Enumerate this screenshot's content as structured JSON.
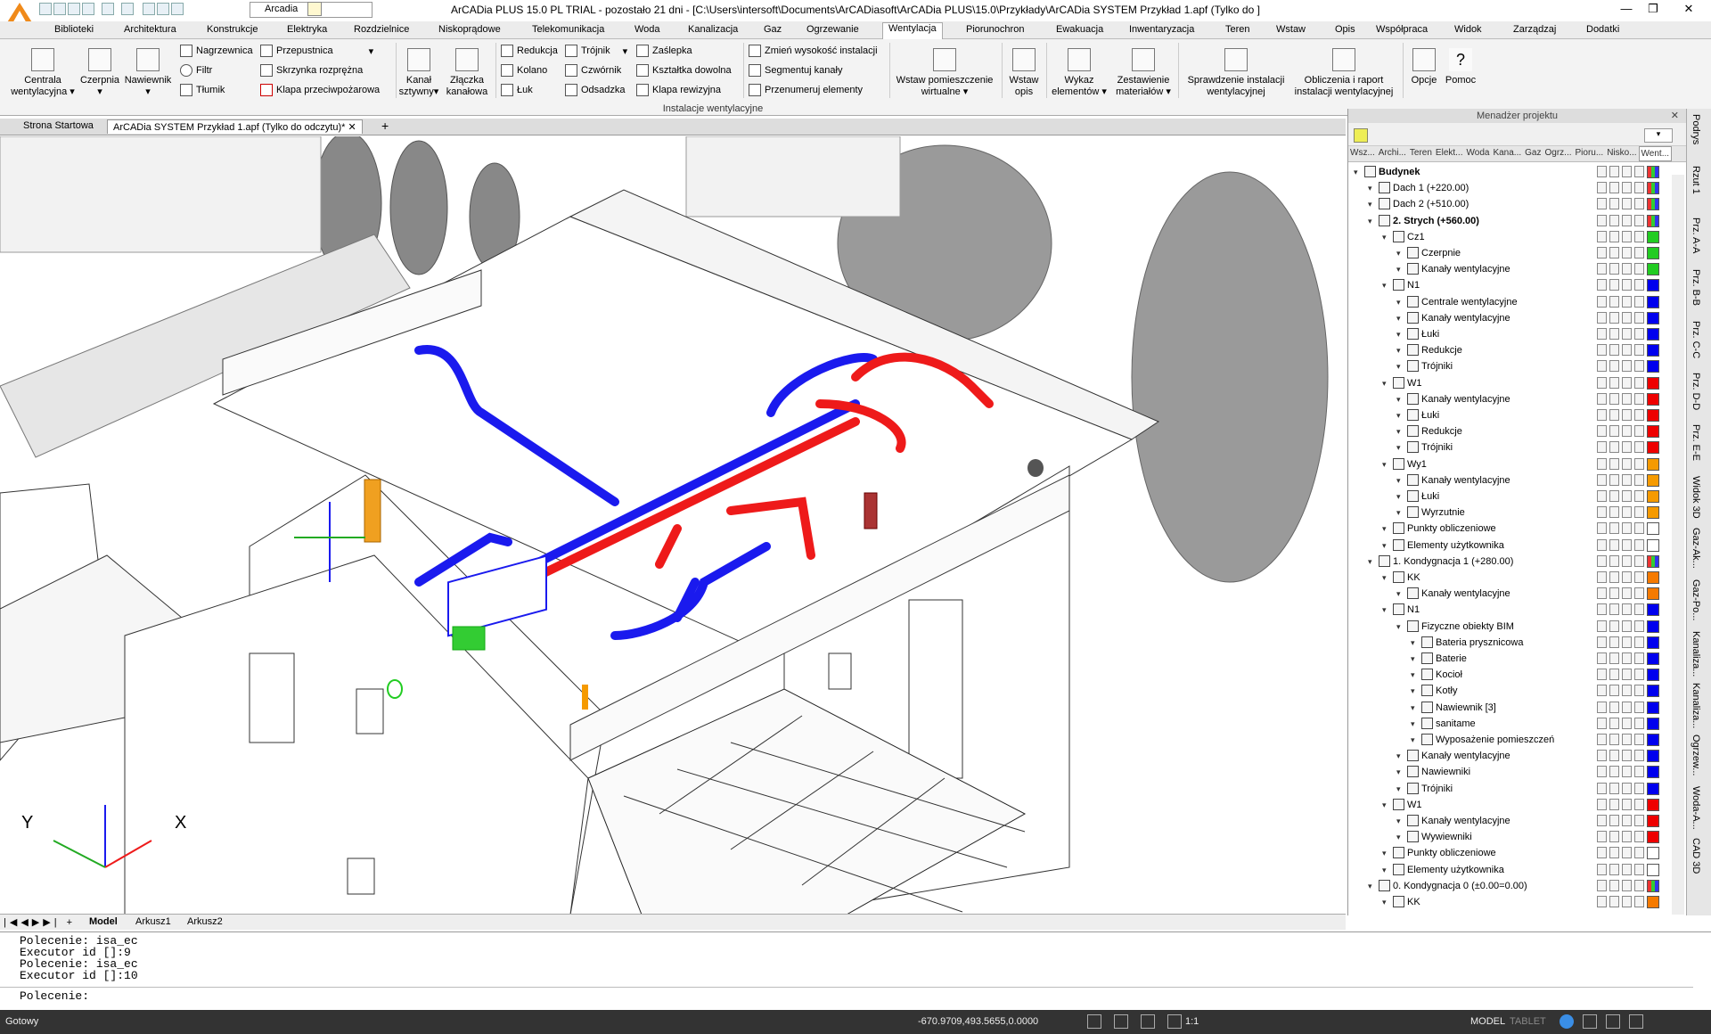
{
  "window": {
    "title": "ArCADia PLUS 15.0 PL TRIAL - pozostało 21 dni - [C:\\Users\\intersoft\\Documents\\ArCADiasoft\\ArCADia PLUS\\15.0\\Przykłady\\ArCADia SYSTEM Przykład 1.apf (Tylko do ]",
    "layer": "Arcadia"
  },
  "menu": [
    "Biblioteki",
    "Architektura",
    "Konstrukcje",
    "Elektryka",
    "Rozdzielnice",
    "Niskoprądowe",
    "Telekomunikacja",
    "Woda",
    "Kanalizacja",
    "Gaz",
    "Ogrzewanie",
    "Wentylacja",
    "Piorunochron",
    "Ewakuacja",
    "Inwentaryzacja",
    "Teren",
    "Wstaw",
    "Opis",
    "Współpraca",
    "Widok",
    "Zarządzaj",
    "Dodatki"
  ],
  "ribbon": {
    "centrala": "Centrala\nwentylacyjna",
    "czerpnia": "Czerpnia",
    "nawiewnik": "Nawiewnik",
    "nagrzewnica": "Nagrzewnica",
    "filtr": "Filtr",
    "tlumik": "Tłumik",
    "przepustnica": "Przepustnica",
    "skrzynka": "Skrzynka rozprężna",
    "klapa_pozarowa": "Klapa przeciwpożarowa",
    "kanal": "Kanał\nsztywny",
    "zlaczka": "Złączka\nkanałowa",
    "redukcja": "Redukcja",
    "kolano": "Kolano",
    "luk": "Łuk",
    "trojnik": "Trójnik",
    "czwornik": "Czwórnik",
    "odsadzka": "Odsadzka",
    "zaslepka": "Zaślepka",
    "ksztaltka": "Kształtka dowolna",
    "klapa_rewizyjna": "Klapa rewizyjna",
    "zmien": "Zmień wysokość instalacji",
    "segmentuj": "Segmentuj kanały",
    "przenumeruj": "Przenumeruj elementy",
    "wstaw_pom": "Wstaw pomieszczenie\nwirtualne",
    "wstaw_opis": "Wstaw\nopis",
    "wykaz": "Wykaz\nelementów",
    "zestawienie": "Zestawienie\nmateriałów",
    "sprawdzenie": "Sprawdzenie instalacji\nwentylacyjnej",
    "obliczenia": "Obliczenia i raport\ninstalacji wentylacyjnej",
    "opcje": "Opcje",
    "pomoc": "Pomoc",
    "caption": "Instalacje wentylacyjne"
  },
  "doc_tabs": [
    "Strona Startowa",
    "ArCADia SYSTEM Przykład 1.apf (Tylko do odczytu)*"
  ],
  "sheet_tabs": [
    "Model",
    "Arkusz1",
    "Arkusz2"
  ],
  "axis": {
    "x": "X",
    "y": "Y"
  },
  "command_lines": [
    "Polecenie: isa_ec",
    "Executor id []:9",
    "Polecenie: isa_ec",
    "Executor id []:10"
  ],
  "command_prompt": "Polecenie:",
  "status": {
    "left": "Gotowy",
    "coords": "-670.9709,493.5655,0.0000",
    "scale": "1:1",
    "model": "MODEL",
    "tablet": "TABLET"
  },
  "panel": {
    "title": "Menadżer projektu",
    "tabs": [
      "Wsz...",
      "Archi...",
      "Teren",
      "Elekt...",
      "Woda",
      "Kana...",
      "Gaz",
      "Ogrz...",
      "Pioru...",
      "Nisko...",
      "Went..."
    ],
    "tree": [
      {
        "label": "Budynek",
        "level": 0,
        "bold": true,
        "color": "multi"
      },
      {
        "label": "Dach 1 (+220.00)",
        "level": 1,
        "color": "multi"
      },
      {
        "label": "Dach 2 (+510.00)",
        "level": 1,
        "color": "multi"
      },
      {
        "label": "2. Strych (+560.00)",
        "level": 1,
        "bold": true,
        "color": "multi"
      },
      {
        "label": "Cz1",
        "level": 2,
        "color": "#22cc22"
      },
      {
        "label": "Czerpnie",
        "level": 3,
        "color": "#22cc22"
      },
      {
        "label": "Kanały wentylacyjne",
        "level": 3,
        "color": "#22cc22"
      },
      {
        "label": "N1",
        "level": 2,
        "color": "#0000ee"
      },
      {
        "label": "Centrale wentylacyjne",
        "level": 3,
        "color": "#0000ee"
      },
      {
        "label": "Kanały wentylacyjne",
        "level": 3,
        "color": "#0000ee"
      },
      {
        "label": "Łuki",
        "level": 3,
        "color": "#0000ee"
      },
      {
        "label": "Redukcje",
        "level": 3,
        "color": "#0000ee"
      },
      {
        "label": "Trójniki",
        "level": 3,
        "color": "#0000ee"
      },
      {
        "label": "W1",
        "level": 2,
        "color": "#ee0000"
      },
      {
        "label": "Kanały wentylacyjne",
        "level": 3,
        "color": "#ee0000"
      },
      {
        "label": "Łuki",
        "level": 3,
        "color": "#ee0000"
      },
      {
        "label": "Redukcje",
        "level": 3,
        "color": "#ee0000"
      },
      {
        "label": "Trójniki",
        "level": 3,
        "color": "#ee0000"
      },
      {
        "label": "Wy1",
        "level": 2,
        "color": "#f59a00"
      },
      {
        "label": "Kanały wentylacyjne",
        "level": 3,
        "color": "#f59a00"
      },
      {
        "label": "Łuki",
        "level": 3,
        "color": "#f59a00"
      },
      {
        "label": "Wyrzutnie",
        "level": 3,
        "color": "#f59a00"
      },
      {
        "label": "Punkty obliczeniowe",
        "level": 2,
        "color": "#ffffff"
      },
      {
        "label": "Elementy użytkownika",
        "level": 2,
        "color": "#ffffff"
      },
      {
        "label": "1. Kondygnacja 1 (+280.00)",
        "level": 1,
        "color": "multi"
      },
      {
        "label": "KK",
        "level": 2,
        "color": "#f57a00"
      },
      {
        "label": "Kanały wentylacyjne",
        "level": 3,
        "color": "#f57a00"
      },
      {
        "label": "N1",
        "level": 2,
        "color": "#0000ee"
      },
      {
        "label": "Fizyczne obiekty BIM",
        "level": 3,
        "color": "#0000ee"
      },
      {
        "label": "Bateria prysznicowa",
        "level": 4,
        "color": "#0000ee"
      },
      {
        "label": "Baterie",
        "level": 4,
        "color": "#0000ee"
      },
      {
        "label": "Kocioł",
        "level": 4,
        "color": "#0000ee"
      },
      {
        "label": "Kotły",
        "level": 4,
        "color": "#0000ee"
      },
      {
        "label": "Nawiewnik [3]",
        "level": 4,
        "color": "#0000ee"
      },
      {
        "label": "sanitame",
        "level": 4,
        "color": "#0000ee"
      },
      {
        "label": "Wyposażenie pomieszczeń",
        "level": 4,
        "color": "#0000ee"
      },
      {
        "label": "Kanały wentylacyjne",
        "level": 3,
        "color": "#0000ee"
      },
      {
        "label": "Nawiewniki",
        "level": 3,
        "color": "#0000ee"
      },
      {
        "label": "Trójniki",
        "level": 3,
        "color": "#0000ee"
      },
      {
        "label": "W1",
        "level": 2,
        "color": "#ee0000"
      },
      {
        "label": "Kanały wentylacyjne",
        "level": 3,
        "color": "#ee0000"
      },
      {
        "label": "Wywiewniki",
        "level": 3,
        "color": "#ee0000"
      },
      {
        "label": "Punkty obliczeniowe",
        "level": 2,
        "color": "#ffffff"
      },
      {
        "label": "Elementy użytkownika",
        "level": 2,
        "color": "#ffffff"
      },
      {
        "label": "0. Kondygnacja 0 (±0.00=0.00)",
        "level": 1,
        "color": "multi"
      },
      {
        "label": "KK",
        "level": 2,
        "color": "#f57a00"
      }
    ]
  },
  "side_tabs": [
    "Podrys",
    "Rzut 1",
    "Prz. A-A",
    "Prz. B-B",
    "Prz. C-C",
    "Prz. D-D",
    "Prz. E-E",
    "Widok 3D",
    "Gaz-Ak...",
    "Gaz-Po...",
    "Kanaliza...",
    "Kanaliza...",
    "Ogrzew...",
    "Woda-A...",
    "CAD 3D"
  ]
}
